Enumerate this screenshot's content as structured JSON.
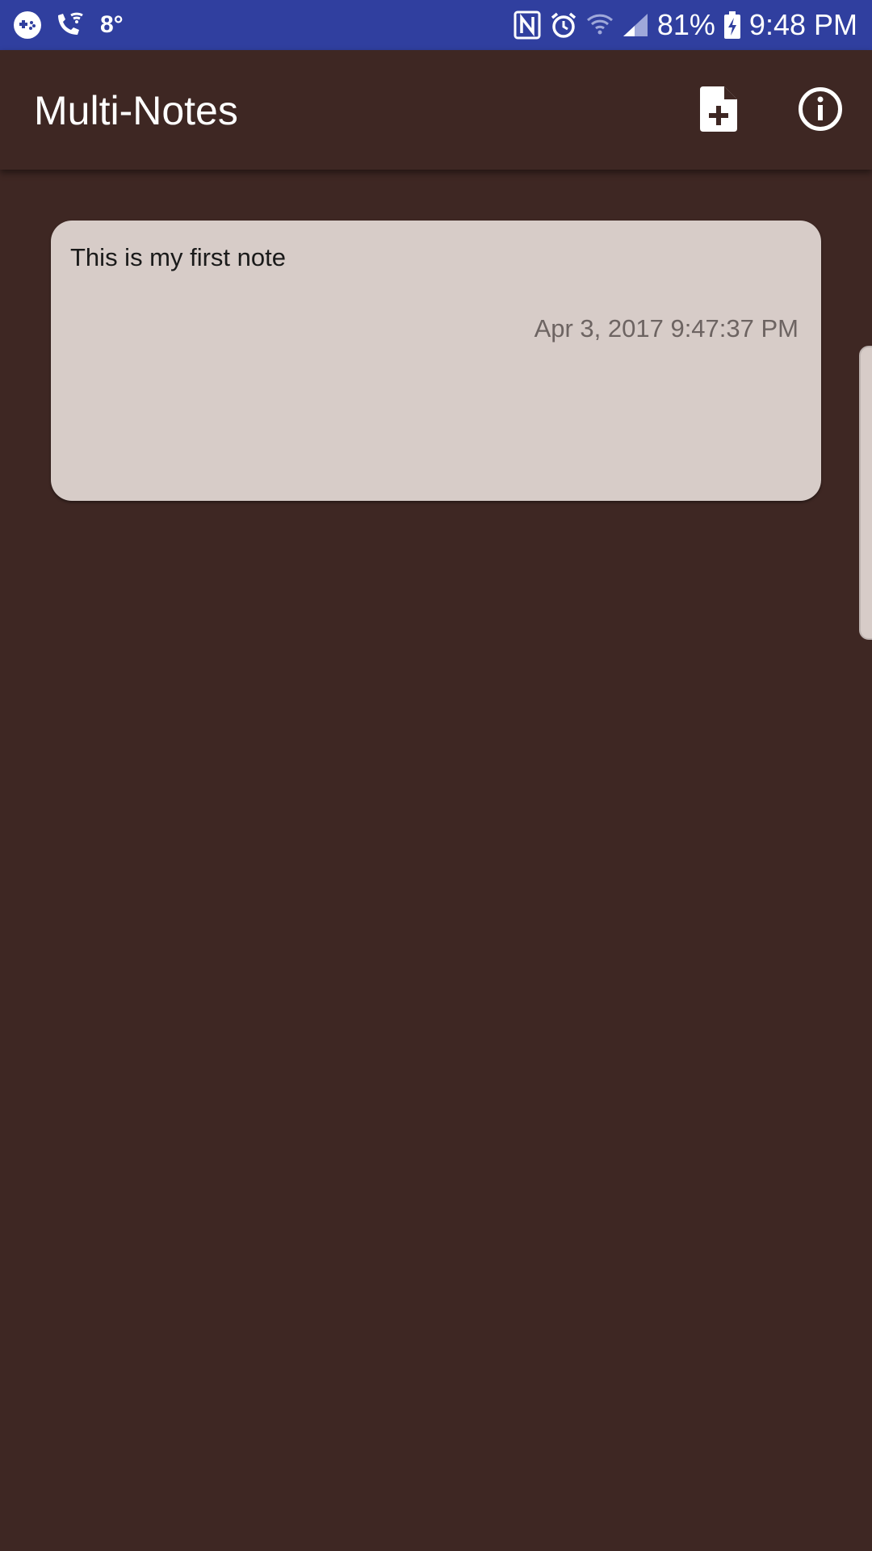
{
  "status_bar": {
    "temperature": "8°",
    "battery": "81%",
    "time": "9:48 PM",
    "icons": [
      "game-controller-icon",
      "wifi-call-icon",
      "nfc-icon",
      "alarm-icon",
      "wifi-icon",
      "signal-icon",
      "battery-charging-icon"
    ]
  },
  "app_bar": {
    "title": "Multi-Notes",
    "actions": [
      "new-note-icon",
      "info-icon"
    ]
  },
  "notes": [
    {
      "title": "This is my first note",
      "date": "Apr 3, 2017 9:47:37 PM"
    }
  ],
  "colors": {
    "status_bar": "#303f9f",
    "background": "#3e2723",
    "card": "#d7ccc8"
  }
}
